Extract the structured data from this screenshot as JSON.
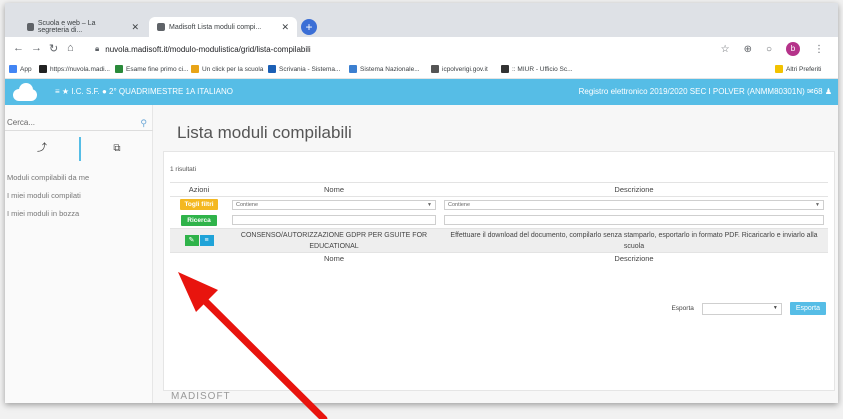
{
  "browser": {
    "tabs": [
      {
        "label": "Scuola e web – La segreteria di..."
      },
      {
        "label": "Madisoft Lista moduli compi..."
      }
    ],
    "url": "nuvola.madisoft.it/modulo-modulistica/grid/lista-compilabili",
    "profile_initial": "b"
  },
  "bookmarks": [
    {
      "label": "App"
    },
    {
      "label": "https://nuvola.madi..."
    },
    {
      "label": "Esame fine primo ci..."
    },
    {
      "label": "Un click per la scuola"
    },
    {
      "label": "Scrivania - Sistema..."
    },
    {
      "label": "Sistema Nazionale..."
    },
    {
      "label": "icpolverigi.gov.it"
    },
    {
      "label": ":: MIUR - Ufficio Sc..."
    },
    {
      "label": "Altri Preferiti"
    }
  ],
  "header": {
    "breadcrumb": "≡ ★  I.C. S.F. ● 2° QUADRIMESTRE 1A ITALIANO",
    "right": "Registro elettronico 2019/2020 SEC I POLVER (ANMM80301N) ✉68 ♟"
  },
  "sidebar": {
    "search_placeholder": "Cerca...",
    "links": [
      "Moduli compilabili da me",
      "I miei moduli compilati",
      "I miei moduli in bozza"
    ]
  },
  "main": {
    "title": "Lista moduli compilabili",
    "result_count": "1 risultati",
    "columns": [
      "Azioni",
      "Nome",
      "Descrizione"
    ],
    "filters": {
      "clear_label": "Togli filtri",
      "search_label": "Ricerca",
      "name_operator": "Contiene",
      "desc_operator": "Contiene"
    },
    "rows": [
      {
        "name": "CONSENSO/AUTORIZZAZIONE GDPR PER GSUITE FOR EDUCATIONAL",
        "description": "Effettuare il download del documento, compilarlo senza stamparlo, esportarlo in formato PDF. Ricaricarlo e inviarlo alla scuola"
      }
    ],
    "export_label": "Esporta",
    "export_button": "Esporta",
    "footer_logo": "MADISOFT"
  },
  "colors": {
    "header_blue": "#56bde6",
    "button_yellow": "#f4b821",
    "button_green": "#2fb34a",
    "arrow_red": "#e8140e"
  }
}
